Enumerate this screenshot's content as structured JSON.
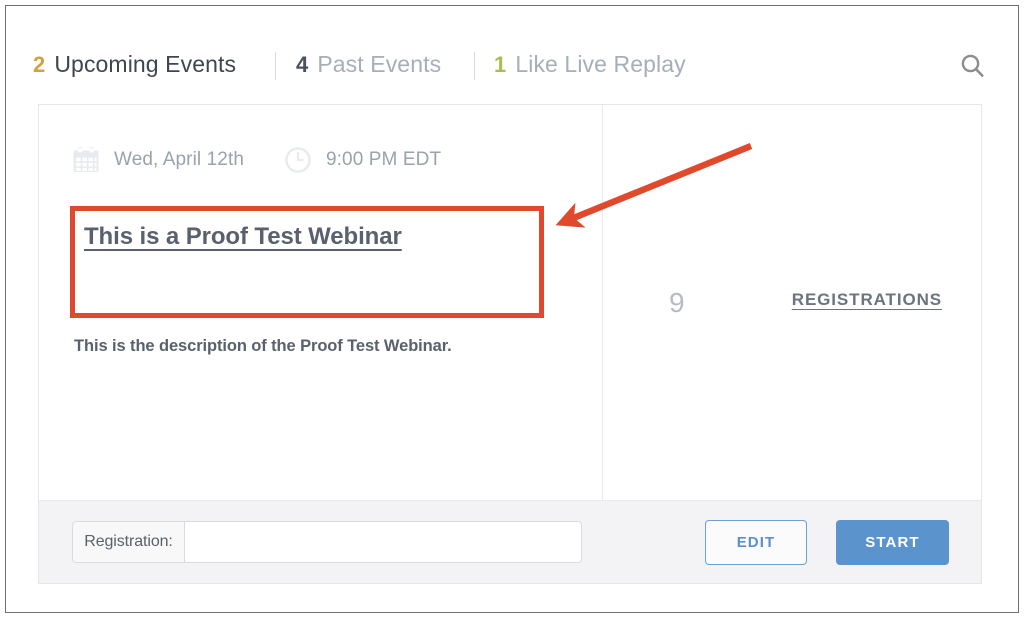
{
  "header": {
    "tabs": [
      {
        "count": "2",
        "label": "Upcoming Events",
        "active": true,
        "count_color": "#d8a martin"
      },
      {
        "count": "4",
        "label": "Past Events",
        "active": false
      },
      {
        "count": "1",
        "label": "Like Live Replay",
        "active": false
      }
    ],
    "search_icon": "search-icon"
  },
  "colors": {
    "count_upcoming": "#d5a041",
    "count_past": "#4a515c",
    "count_replay": "#a8bf4e",
    "label_active": "#3f4650",
    "label_inactive": "#a6aeb8",
    "annotation_red": "#e0492c",
    "primary_blue": "#5b93cd"
  },
  "event": {
    "date_icon": "calendar-icon",
    "date": "Wed, April 12th",
    "time_icon": "clock-icon",
    "time": "9:00 PM EDT",
    "title": "This is a Proof Test Webinar",
    "description": "This is the description of the Proof Test Webinar.",
    "registrations_count": "9",
    "registrations_label": "REGISTRATIONS"
  },
  "footer": {
    "registration_prefix": "Registration:",
    "registration_value": "",
    "registration_placeholder": "",
    "edit_label": "EDIT",
    "start_label": "START"
  },
  "annotation": {
    "type": "arrow",
    "color": "#e0492c",
    "points_to": "event-title-highlight"
  }
}
